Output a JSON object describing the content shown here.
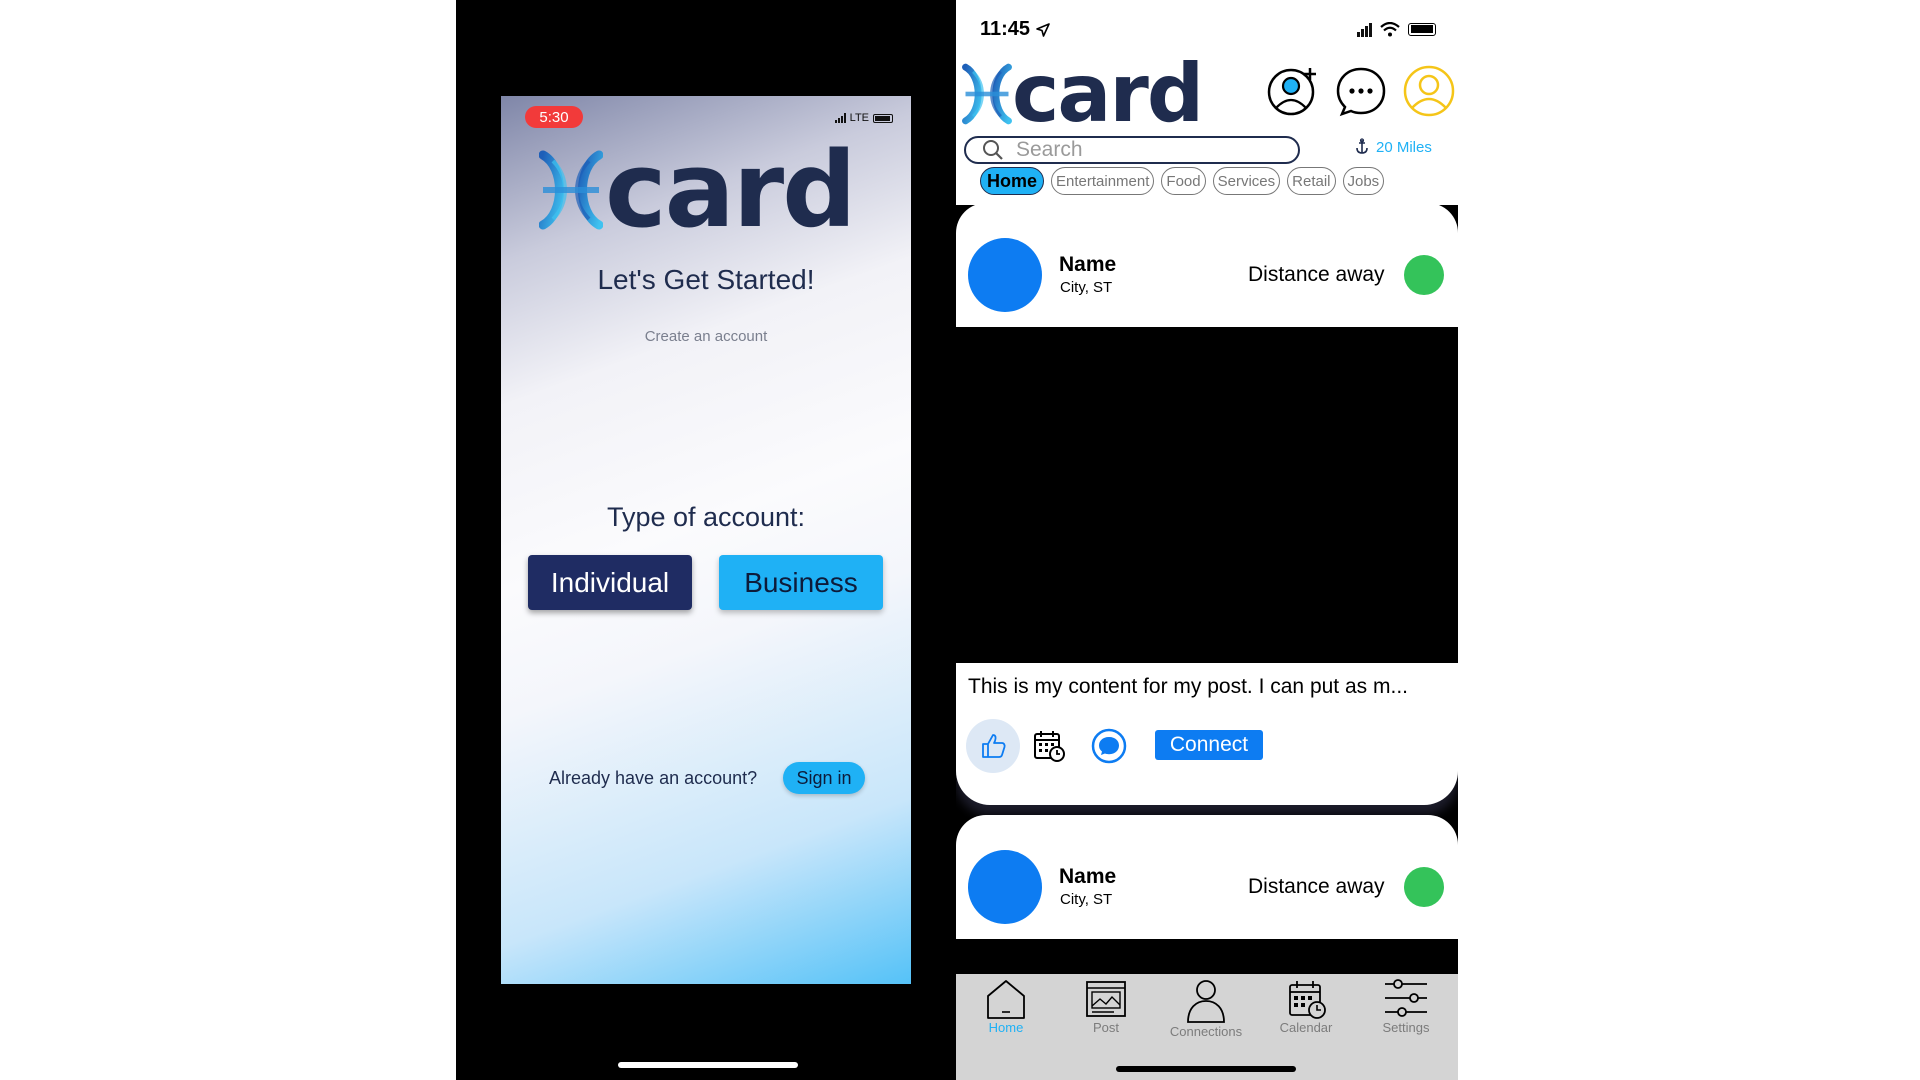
{
  "left_screen": {
    "status": {
      "time": "5:30",
      "network": "LTE"
    },
    "logo_text": "card",
    "heading": "Let's Get Started!",
    "subheading": "Create an account",
    "account_type_label": "Type of account:",
    "individual_label": "Individual",
    "business_label": "Business",
    "already_text": "Already have an account?",
    "signin_label": "Sign in"
  },
  "right_screen": {
    "status": {
      "time": "11:45"
    },
    "logo_text": "card",
    "search": {
      "placeholder": "Search"
    },
    "distance_filter": "20 Miles",
    "tabs": [
      "Home",
      "Entertainment",
      "Food",
      "Services",
      "Retail",
      "Jobs"
    ],
    "active_tab": "Home",
    "posts": [
      {
        "name": "Name",
        "city": "City, ST",
        "distance": "Distance away",
        "content": "This is my content for my post. I can put as m...",
        "connect_label": "Connect"
      },
      {
        "name": "Name",
        "city": "City, ST",
        "distance": "Distance away"
      }
    ],
    "tabbar": [
      {
        "label": "Home",
        "icon": "home-icon"
      },
      {
        "label": "Post",
        "icon": "post-icon"
      },
      {
        "label": "Connections",
        "icon": "person-icon"
      },
      {
        "label": "Calendar",
        "icon": "calendar-icon"
      },
      {
        "label": "Settings",
        "icon": "sliders-icon"
      }
    ],
    "header_icons": [
      "add-contact-icon",
      "chat-icon",
      "profile-icon"
    ]
  },
  "colors": {
    "navy": "#1f2c4e",
    "accent_blue": "#1fb1f5",
    "avatar_blue": "#0d7cf2",
    "status_green": "#34c35a",
    "alert_red": "#f23a3a"
  }
}
